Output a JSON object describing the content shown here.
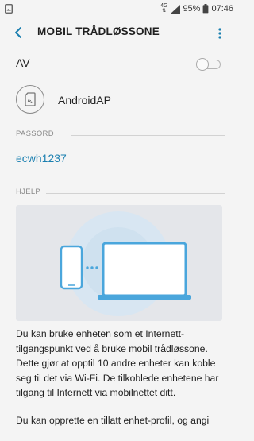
{
  "status_bar": {
    "network_type": "4G",
    "battery": "95%",
    "time": "07:46"
  },
  "app_bar": {
    "title": "MOBIL TRÅDLØSSONE"
  },
  "toggle_row": {
    "label": "AV",
    "state": "off"
  },
  "access_point": {
    "name": "AndroidAP"
  },
  "password_section": {
    "header": "PASSORD",
    "value": "ecwh1237"
  },
  "help_section": {
    "header": "HJELP",
    "paragraph_1": "Du kan bruke enheten som et Internett-tilgangspunkt ved å bruke mobil trådløssone. Dette gjør at opptil 10 andre enheter kan koble seg til det via Wi-Fi. De tilkoblede enhetene har tilgang til Internett via mobilnettet ditt.",
    "paragraph_2": "Du kan opprette en tillatt enhet-profil, og angi"
  },
  "colors": {
    "accent": "#1a7fb0",
    "background": "#f4f4f4",
    "illustration_bg": "#e4e6ea",
    "device_blue": "#4aa6dc"
  }
}
